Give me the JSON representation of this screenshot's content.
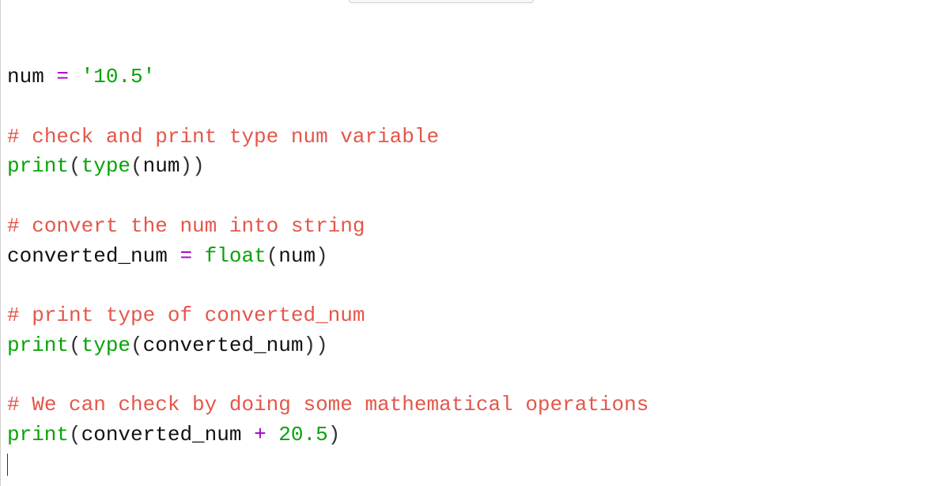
{
  "code": {
    "l1": {
      "var": "num",
      "op": " = ",
      "q1": "'",
      "str": "10.5",
      "q2": "'"
    },
    "l2": {
      "hash": "#",
      "cmt": " check and print type num variable"
    },
    "l3": {
      "fn": "print",
      "p1": "(",
      "tfn": "type",
      "p2": "(",
      "arg": "num",
      "p3": ")",
      ")": ")"
    },
    "l4": {
      "hash": "#",
      "cmt": " convert the num into string"
    },
    "l5": {
      "var": "converted_num",
      "op": " = ",
      "ffn": "float",
      "p1": "(",
      "arg": "num",
      "p2": ")"
    },
    "l6": {
      "hash": "#",
      "cmt": " print type of converted_num"
    },
    "l7": {
      "fn": "print",
      "p1": "(",
      "tfn": "type",
      "p2": "(",
      "arg": "converted_num",
      "p3": ")",
      ")": ")"
    },
    "l8": {
      "hash": "#",
      "cmt": " We can check by doing some mathematical operations"
    },
    "l9": {
      "fn": "print",
      "p1": "(",
      "arg": "converted_num",
      "op": " + ",
      "num": "20.5",
      "p2": ")"
    }
  }
}
